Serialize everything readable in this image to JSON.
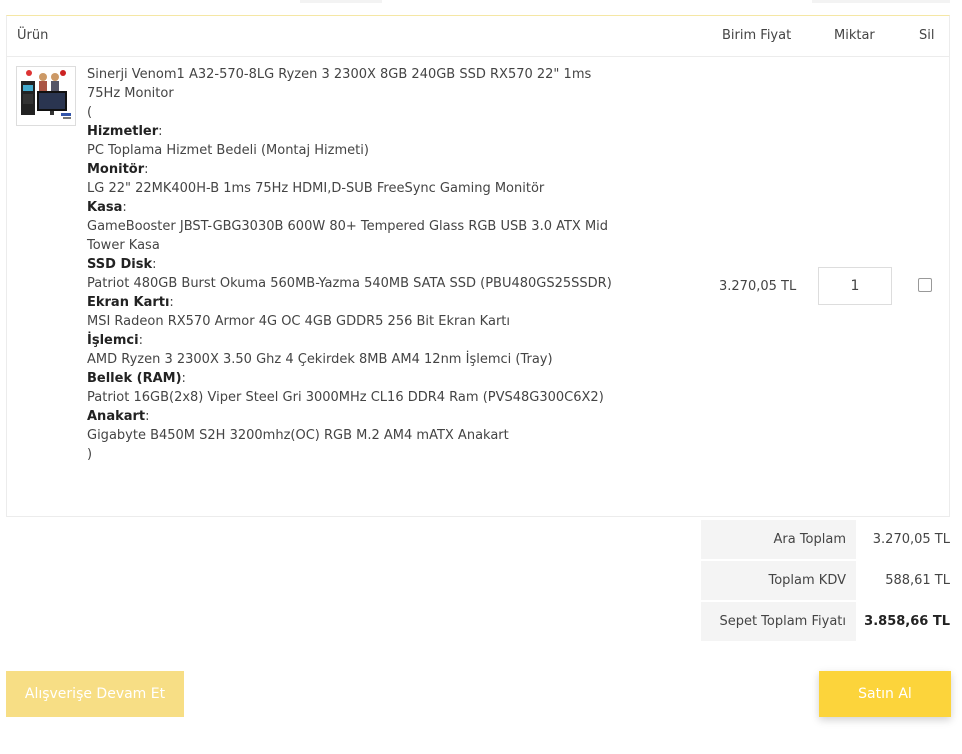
{
  "table": {
    "headers": {
      "product": "Ürün",
      "unit_price": "Birim Fiyat",
      "quantity": "Miktar",
      "delete": "Sil"
    },
    "item": {
      "title": "Sinerji Venom1 A32-570-8LG Ryzen 3 2300X 8GB 240GB SSD RX570 22\" 1ms 75Hz Monitor",
      "open_paren": "(",
      "close_paren": ")",
      "specs": [
        {
          "label": "Hizmetler",
          "value": "PC Toplama Hizmet Bedeli (Montaj Hizmeti)"
        },
        {
          "label": "Monitör",
          "value": "LG 22\" 22MK400H-B 1ms 75Hz HDMI,D-SUB FreeSync Gaming Monitör"
        },
        {
          "label": "Kasa",
          "value": "GameBooster JBST-GBG3030B 600W 80+ Tempered Glass RGB USB 3.0 ATX Mid Tower Kasa"
        },
        {
          "label": "SSD Disk",
          "value": "Patriot 480GB Burst Okuma 560MB-Yazma 540MB SATA SSD (PBU480GS25SSDR)"
        },
        {
          "label": "Ekran Kartı",
          "value": "MSI Radeon RX570 Armor 4G OC 4GB GDDR5 256 Bit Ekran Kartı"
        },
        {
          "label": "İşlemci",
          "value": "AMD Ryzen 3 2300X 3.50 Ghz 4 Çekirdek 8MB AM4 12nm İşlemci (Tray)"
        },
        {
          "label": "Bellek (RAM)",
          "value": "Patriot 16GB(2x8) Viper Steel Gri 3000MHz CL16 DDR4 Ram (PVS48G300C6X2)"
        },
        {
          "label": "Anakart",
          "value": "Gigabyte B450M S2H 3200mhz(OC) RGB M.2 AM4 mATX Anakart"
        }
      ],
      "colon": ":",
      "unit_price": "3.270,05 TL",
      "quantity": "1"
    }
  },
  "totals": {
    "subtotal_label": "Ara Toplam",
    "subtotal_value": "3.270,05 TL",
    "vat_label": "Toplam KDV",
    "vat_value": "588,61 TL",
    "total_label": "Sepet Toplam Fiyatı",
    "total_value": "3.858,66 TL"
  },
  "buttons": {
    "continue_shopping": "Alışverişe Devam Et",
    "buy": "Satın Al"
  },
  "colors": {
    "accent": "#fcd43b",
    "accent_light": "#f7de85"
  }
}
